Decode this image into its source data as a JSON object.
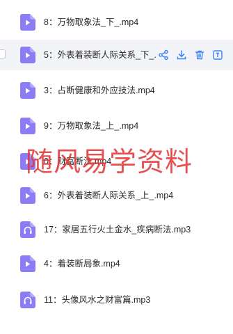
{
  "files": [
    {
      "name": "8：万物取象法_下_.mp4",
      "type": "video"
    },
    {
      "name": "5：外表着装断人际关系_下_.mp4",
      "type": "video"
    },
    {
      "name": "3：占断健康和外应技法.mp4",
      "type": "video"
    },
    {
      "name": "9：万物取象法_上_.mp4",
      "type": "video"
    },
    {
      "name": "0：财富断法.mp4",
      "type": "video"
    },
    {
      "name": "6：外表着装断人际关系_上_.mp4",
      "type": "video"
    },
    {
      "name": "17：家居五行火土金水_疾病断法.mp3",
      "type": "audio"
    },
    {
      "name": "4：着装断局象.mp4",
      "type": "video"
    },
    {
      "name": "11：头像风水之财富篇.mp3",
      "type": "audio"
    }
  ],
  "hovered_index": 1,
  "row_actions": [
    "share-icon",
    "download-icon",
    "delete-icon",
    "rename-icon",
    "more-icon"
  ],
  "watermark": "随风易学资料",
  "colors": {
    "icon_purple": "#8c7cf6",
    "hover_bg": "#f3f4f8",
    "action_blue": "#3b82f6",
    "watermark_red": "#e23838"
  }
}
